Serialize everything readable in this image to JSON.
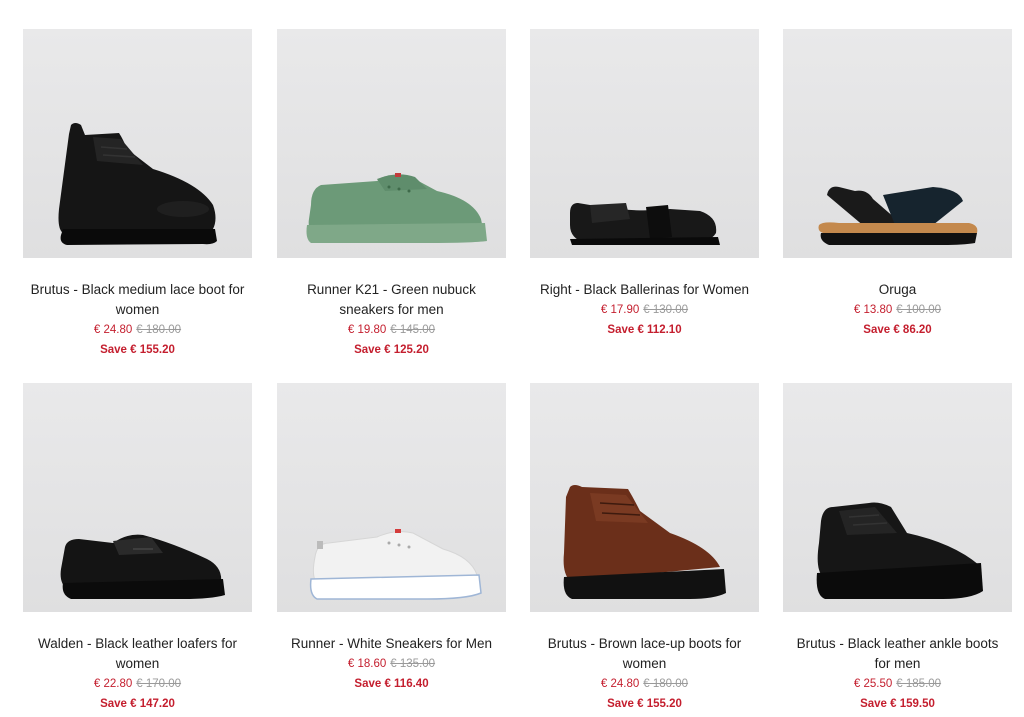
{
  "products": [
    {
      "title": "Brutus - Black medium lace boot for women",
      "price": "€ 24.80",
      "old_price": "€ 180.00",
      "save": "Save € 155.20",
      "image": "black-lace-boot"
    },
    {
      "title": "Runner K21 - Green nubuck sneakers for men",
      "price": "€ 19.80",
      "old_price": "€ 145.00",
      "save": "Save € 125.20",
      "image": "green-sneaker"
    },
    {
      "title": "Right - Black Ballerinas for Women",
      "price": "€ 17.90",
      "old_price": "€ 130.00",
      "save": "Save € 112.10",
      "image": "black-ballerina"
    },
    {
      "title": "Oruga",
      "price": "€ 13.80",
      "old_price": "€ 100.00",
      "save": "Save € 86.20",
      "image": "black-sandal"
    },
    {
      "title": "Walden - Black leather loafers for women",
      "price": "€ 22.80",
      "old_price": "€ 170.00",
      "save": "Save € 147.20",
      "image": "black-loafer"
    },
    {
      "title": "Runner - White Sneakers for Men",
      "price": "€ 18.60",
      "old_price": "€ 135.00",
      "save": "Save € 116.40",
      "image": "white-sneaker"
    },
    {
      "title": "Brutus - Brown lace-up boots for women",
      "price": "€ 24.80",
      "old_price": "€ 180.00",
      "save": "Save € 155.20",
      "image": "brown-lace-boot"
    },
    {
      "title": "Brutus - Black leather ankle boots for men",
      "price": "€ 25.50",
      "old_price": "€ 185.00",
      "save": "Save € 159.50",
      "image": "black-ankle-boot"
    }
  ],
  "colors": {
    "sale": "#c41e2e",
    "old_price": "#9a9a9a",
    "text": "#222222"
  }
}
